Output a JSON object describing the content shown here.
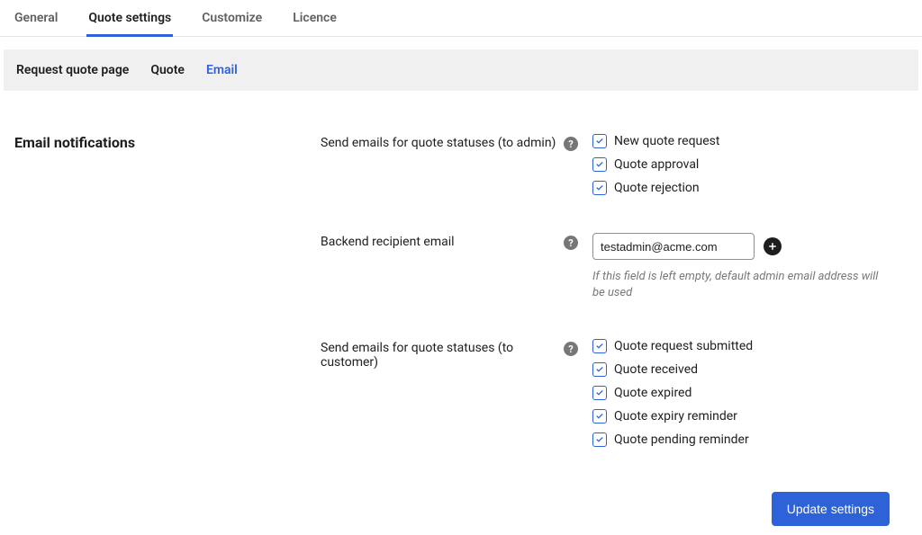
{
  "top_tabs": {
    "general": "General",
    "quote_settings": "Quote settings",
    "customize": "Customize",
    "licence": "Licence"
  },
  "sub_tabs": {
    "request_quote_page": "Request quote page",
    "quote": "Quote",
    "email": "Email"
  },
  "section_title": "Email notifications",
  "fields": {
    "admin_statuses": {
      "label": "Send emails for quote statuses (to admin)",
      "options": {
        "new_quote_request": "New quote request",
        "quote_approval": "Quote approval",
        "quote_rejection": "Quote rejection"
      }
    },
    "backend_email": {
      "label": "Backend recipient email",
      "value": "testadmin@acme.com",
      "helper": "If this field is left empty, default admin email address will be used"
    },
    "customer_statuses": {
      "label": "Send emails for quote statuses (to customer)",
      "options": {
        "quote_request_submitted": "Quote request submitted",
        "quote_received": "Quote received",
        "quote_expired": "Quote expired",
        "quote_expiry_reminder": "Quote expiry reminder",
        "quote_pending_reminder": "Quote pending reminder"
      }
    }
  },
  "buttons": {
    "update_settings": "Update settings"
  },
  "glyphs": {
    "help": "?"
  }
}
